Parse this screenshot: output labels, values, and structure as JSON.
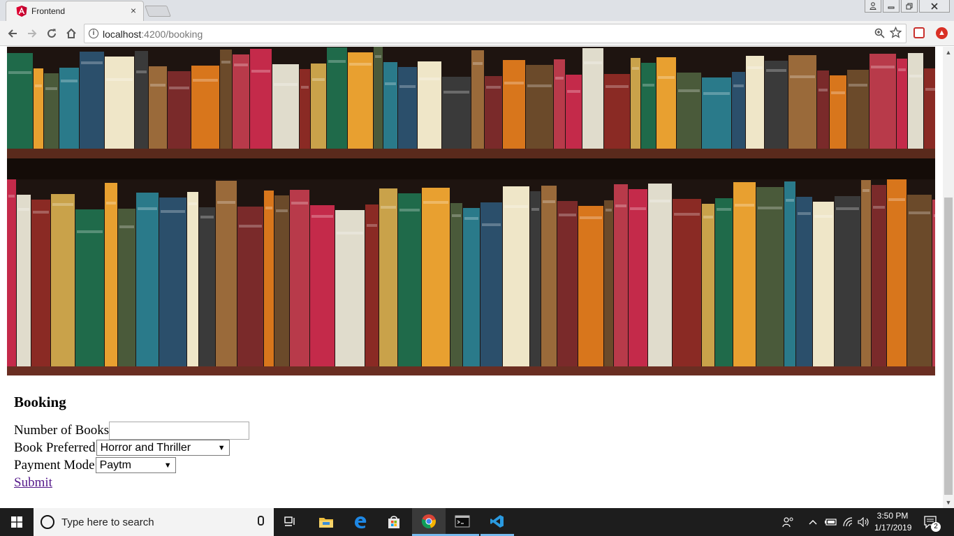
{
  "browser": {
    "tab_title": "Frontend",
    "tab_close": "×",
    "url_host": "localhost",
    "url_path": ":4200/booking"
  },
  "page": {
    "heading": "Booking",
    "form": {
      "books_label": "Number of Books",
      "books_value": "",
      "preferred_label": "Book Preferred",
      "preferred_selected": "Horror and Thriller",
      "payment_label": "Payment Mode",
      "payment_selected": "Paytm",
      "submit_label": "Submit"
    }
  },
  "taskbar": {
    "search_placeholder": "Type here to search",
    "time": "3:50 PM",
    "date": "1/17/2019",
    "notification_count": "2"
  },
  "icons": [
    "angular-icon",
    "back-icon",
    "forward-icon",
    "reload-icon",
    "home-icon",
    "info-icon",
    "zoom-icon",
    "star-icon",
    "pocket-icon",
    "extension-icon",
    "windows-logo-icon",
    "cortana-icon",
    "mic-icon",
    "task-view-icon",
    "file-explorer-icon",
    "edge-icon",
    "store-icon",
    "chrome-icon",
    "terminal-icon",
    "vscode-icon",
    "people-icon",
    "battery-icon",
    "wifi-icon",
    "volume-icon",
    "notification-icon"
  ],
  "colors": {
    "link_visited": "#551a8b",
    "taskbar": "#1d1d1d",
    "taskbar_accent": "#76b9ed"
  }
}
